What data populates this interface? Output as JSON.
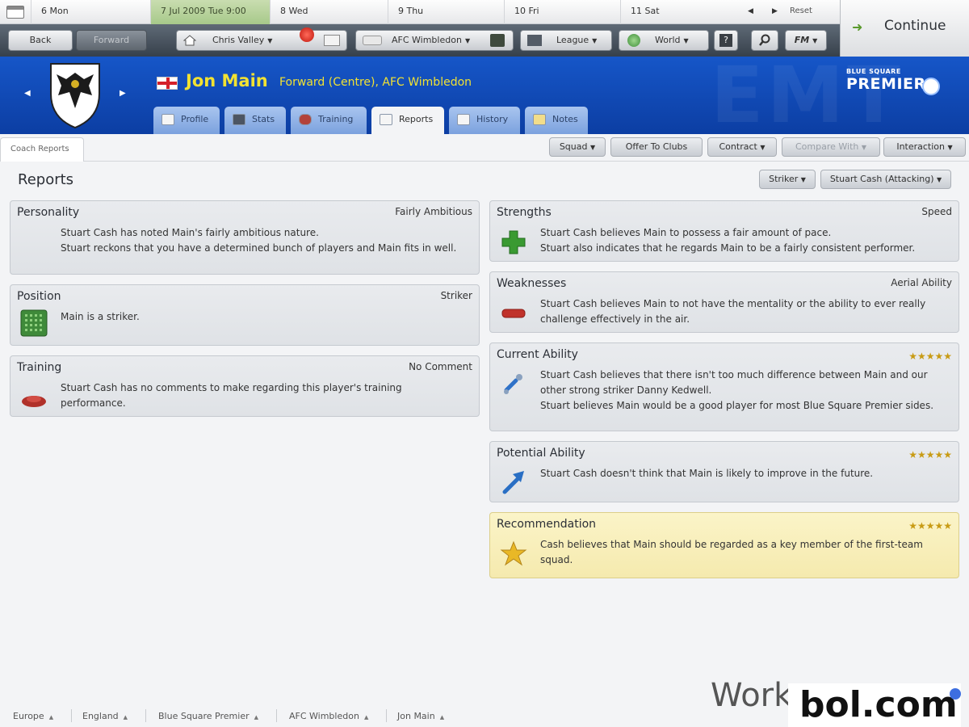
{
  "calendar": {
    "days": [
      {
        "label": "6 Mon"
      },
      {
        "label": "7 Jul 2009  Tue  9:00"
      },
      {
        "label": "8 Wed"
      },
      {
        "label": "9 Thu"
      },
      {
        "label": "10 Fri"
      },
      {
        "label": "11 Sat"
      }
    ],
    "reset": "Reset",
    "prev": "◀",
    "next": "▶"
  },
  "navbar": {
    "back": "Back",
    "forward": "Forward",
    "manager": "Chris Valley",
    "club": "AFC Wimbledon",
    "league": "League",
    "world": "World",
    "fm": "FM",
    "continue": "Continue"
  },
  "player": {
    "name": "Jon Main",
    "description": "Forward (Centre), AFC Wimbledon",
    "league_line1": "BLUE SQUARE",
    "league_line2": "PREMIER"
  },
  "tabs": [
    {
      "label": "Profile"
    },
    {
      "label": "Stats"
    },
    {
      "label": "Training"
    },
    {
      "label": "Reports"
    },
    {
      "label": "History"
    },
    {
      "label": "Notes"
    }
  ],
  "subbar": {
    "coach_reports": "Coach Reports",
    "squad": "Squad",
    "offer": "Offer To Clubs",
    "contract": "Contract",
    "compare": "Compare With",
    "interaction": "Interaction"
  },
  "reports": {
    "title": "Reports",
    "filter_role": "Striker",
    "filter_coach": "Stuart Cash (Attacking)",
    "personality": {
      "title": "Personality",
      "value": "Fairly Ambitious",
      "text": "Stuart Cash has noted Main's fairly ambitious nature.\nStuart reckons that you have a determined bunch of players and Main fits in well."
    },
    "position": {
      "title": "Position",
      "value": "Striker",
      "text": "Main is a striker."
    },
    "training": {
      "title": "Training",
      "value": "No Comment",
      "text": "Stuart Cash has no comments to make regarding this player's training performance."
    },
    "strengths": {
      "title": "Strengths",
      "value": "Speed",
      "text": "Stuart Cash believes Main to possess a fair amount of pace.\nStuart also indicates that he regards Main to be a fairly consistent performer."
    },
    "weaknesses": {
      "title": "Weaknesses",
      "value": "Aerial Ability",
      "text": "Stuart Cash believes Main to not have the mentality or the ability to ever really challenge effectively in the air."
    },
    "current_ability": {
      "title": "Current Ability",
      "stars": "★★★★★",
      "text": "Stuart Cash believes that there isn't too much difference between Main and our other strong striker Danny Kedwell.\nStuart believes Main would be a good player for most Blue Square Premier sides."
    },
    "potential_ability": {
      "title": "Potential Ability",
      "stars": "★★★★★",
      "text": "Stuart Cash doesn't think that Main is likely to improve in the future."
    },
    "recommendation": {
      "title": "Recommendation",
      "stars": "★★★★★",
      "text": "Cash believes that Main should be regarded as a key member of the first-team squad."
    }
  },
  "breadcrumb": [
    {
      "label": "Europe"
    },
    {
      "label": "England"
    },
    {
      "label": "Blue Square Premier"
    },
    {
      "label": "AFC Wimbledon"
    },
    {
      "label": "Jon Main"
    }
  ],
  "watermark": {
    "part1": "Work",
    "part2": "bol.com"
  },
  "colors": {
    "header_blue": "#1656c8",
    "name_yellow": "#f2e232",
    "recommendation_bg": "#f8efbb"
  }
}
